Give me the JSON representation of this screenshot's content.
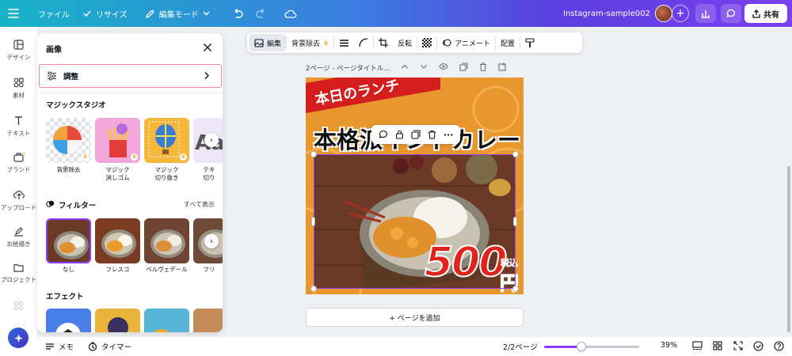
{
  "topbar": {
    "file_label": "ファイル",
    "resize_label": "リサイズ",
    "edit_mode_label": "編集モード",
    "doc_title": "Instagram-sample002",
    "share_label": "共有"
  },
  "rail": {
    "items": [
      {
        "label": "デザイン",
        "icon": "layout-icon"
      },
      {
        "label": "素材",
        "icon": "shapes-icon"
      },
      {
        "label": "テキスト",
        "icon": "text-icon"
      },
      {
        "label": "ブランド",
        "icon": "brand-icon"
      },
      {
        "label": "アップロード",
        "icon": "upload-icon"
      },
      {
        "label": "お絵描き",
        "icon": "draw-icon"
      },
      {
        "label": "プロジェクト",
        "icon": "folder-icon"
      }
    ]
  },
  "panel": {
    "title": "画像",
    "adjust_label": "調整",
    "magic_section": "マジックスタジオ",
    "magic_items": [
      {
        "label_1": "背景除去",
        "label_2": ""
      },
      {
        "label_1": "マジック",
        "label_2": "消しゴム"
      },
      {
        "label_1": "マジック",
        "label_2": "切り抜き"
      },
      {
        "label_1": "テキ",
        "label_2": "切り"
      }
    ],
    "filter_section": "フィルター",
    "see_all": "すべて表示",
    "filter_items": [
      "なし",
      "フレスコ",
      "ベルヴェデール",
      "フリ"
    ],
    "effect_section": "エフェクト"
  },
  "image_toolbar": {
    "edit_label": "編集",
    "bg_remove_label": "背景除去",
    "flip_label": "反転",
    "animate_label": "アニメート",
    "position_label": "配置"
  },
  "page": {
    "header": "2ページ - ページタイトル...",
    "add_page_label": "+ ページを追加"
  },
  "design": {
    "lunch_text": "本日のランチ",
    "headline": "本格派インドカレー",
    "price": "500",
    "tax_label": "税込",
    "yen_label": "円"
  },
  "bottombar": {
    "notes_label": "メモ",
    "timer_label": "タイマー",
    "page_indicator": "2/2ページ",
    "zoom": "39%",
    "zoom_fraction": 0.39
  }
}
